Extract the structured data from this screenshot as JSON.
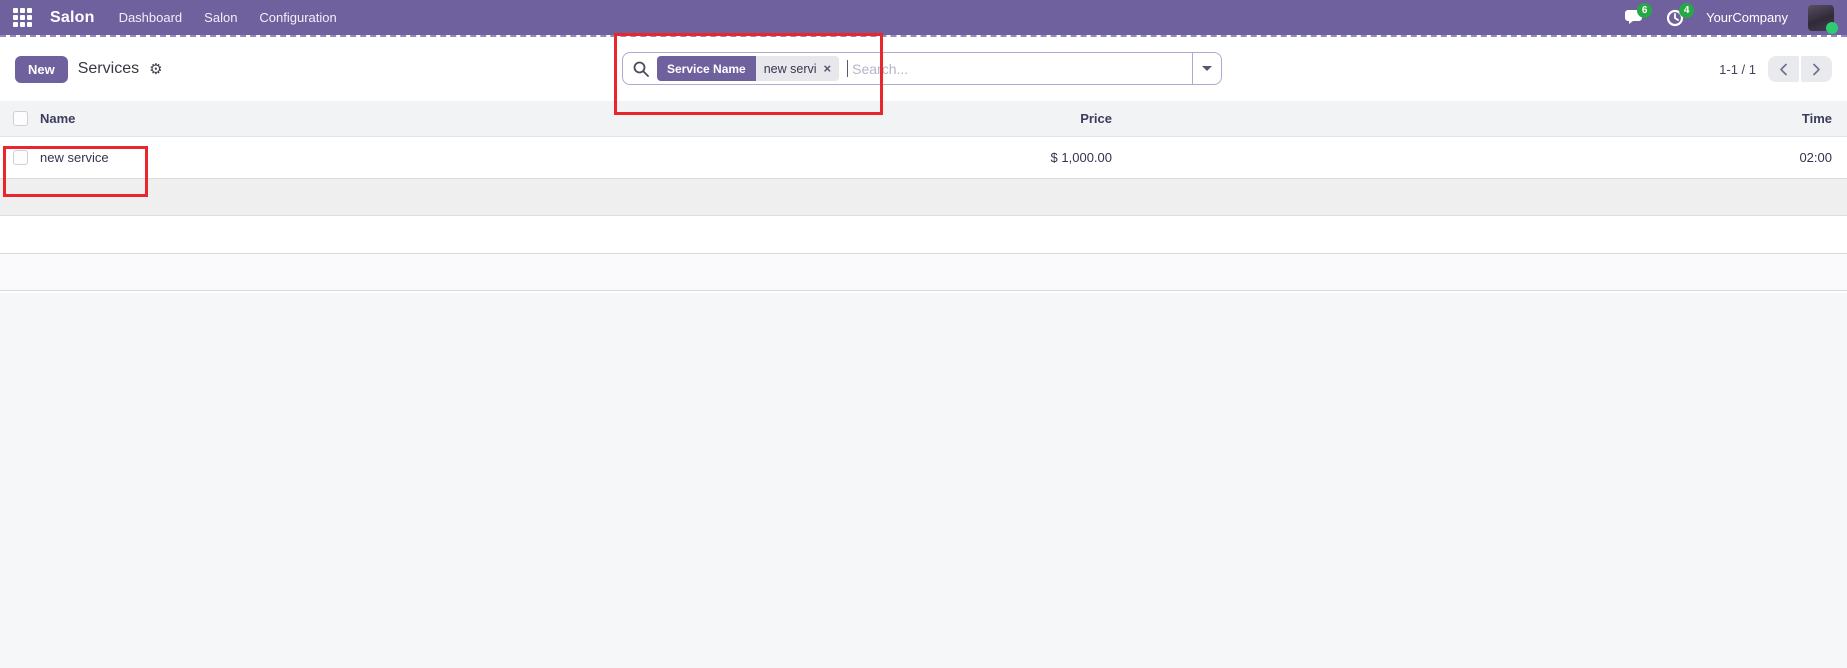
{
  "navbar": {
    "brand": "Salon",
    "menu_items": [
      {
        "label": "Dashboard"
      },
      {
        "label": "Salon"
      },
      {
        "label": "Configuration"
      }
    ],
    "messages_count": "6",
    "activities_count": "4",
    "company": "YourCompany"
  },
  "control_panel": {
    "new_button": "New",
    "breadcrumb": "Services",
    "gear_icon_glyph": "⚙",
    "search": {
      "facet_label": "Service Name",
      "facet_value": "new servi",
      "remove_icon_glyph": "×",
      "placeholder": "Search..."
    },
    "pager": {
      "range": "1-1 / 1"
    }
  },
  "table": {
    "columns": [
      "Name",
      "Price",
      "Time"
    ],
    "rows": [
      {
        "name": "new service",
        "price": "$ 1,000.00",
        "time": "02:00"
      }
    ]
  },
  "colors": {
    "accent_purple": "#6e619e",
    "badge_green": "#28a745",
    "annotation_red": "#e8262c",
    "content_background": "#f6f7f9"
  }
}
